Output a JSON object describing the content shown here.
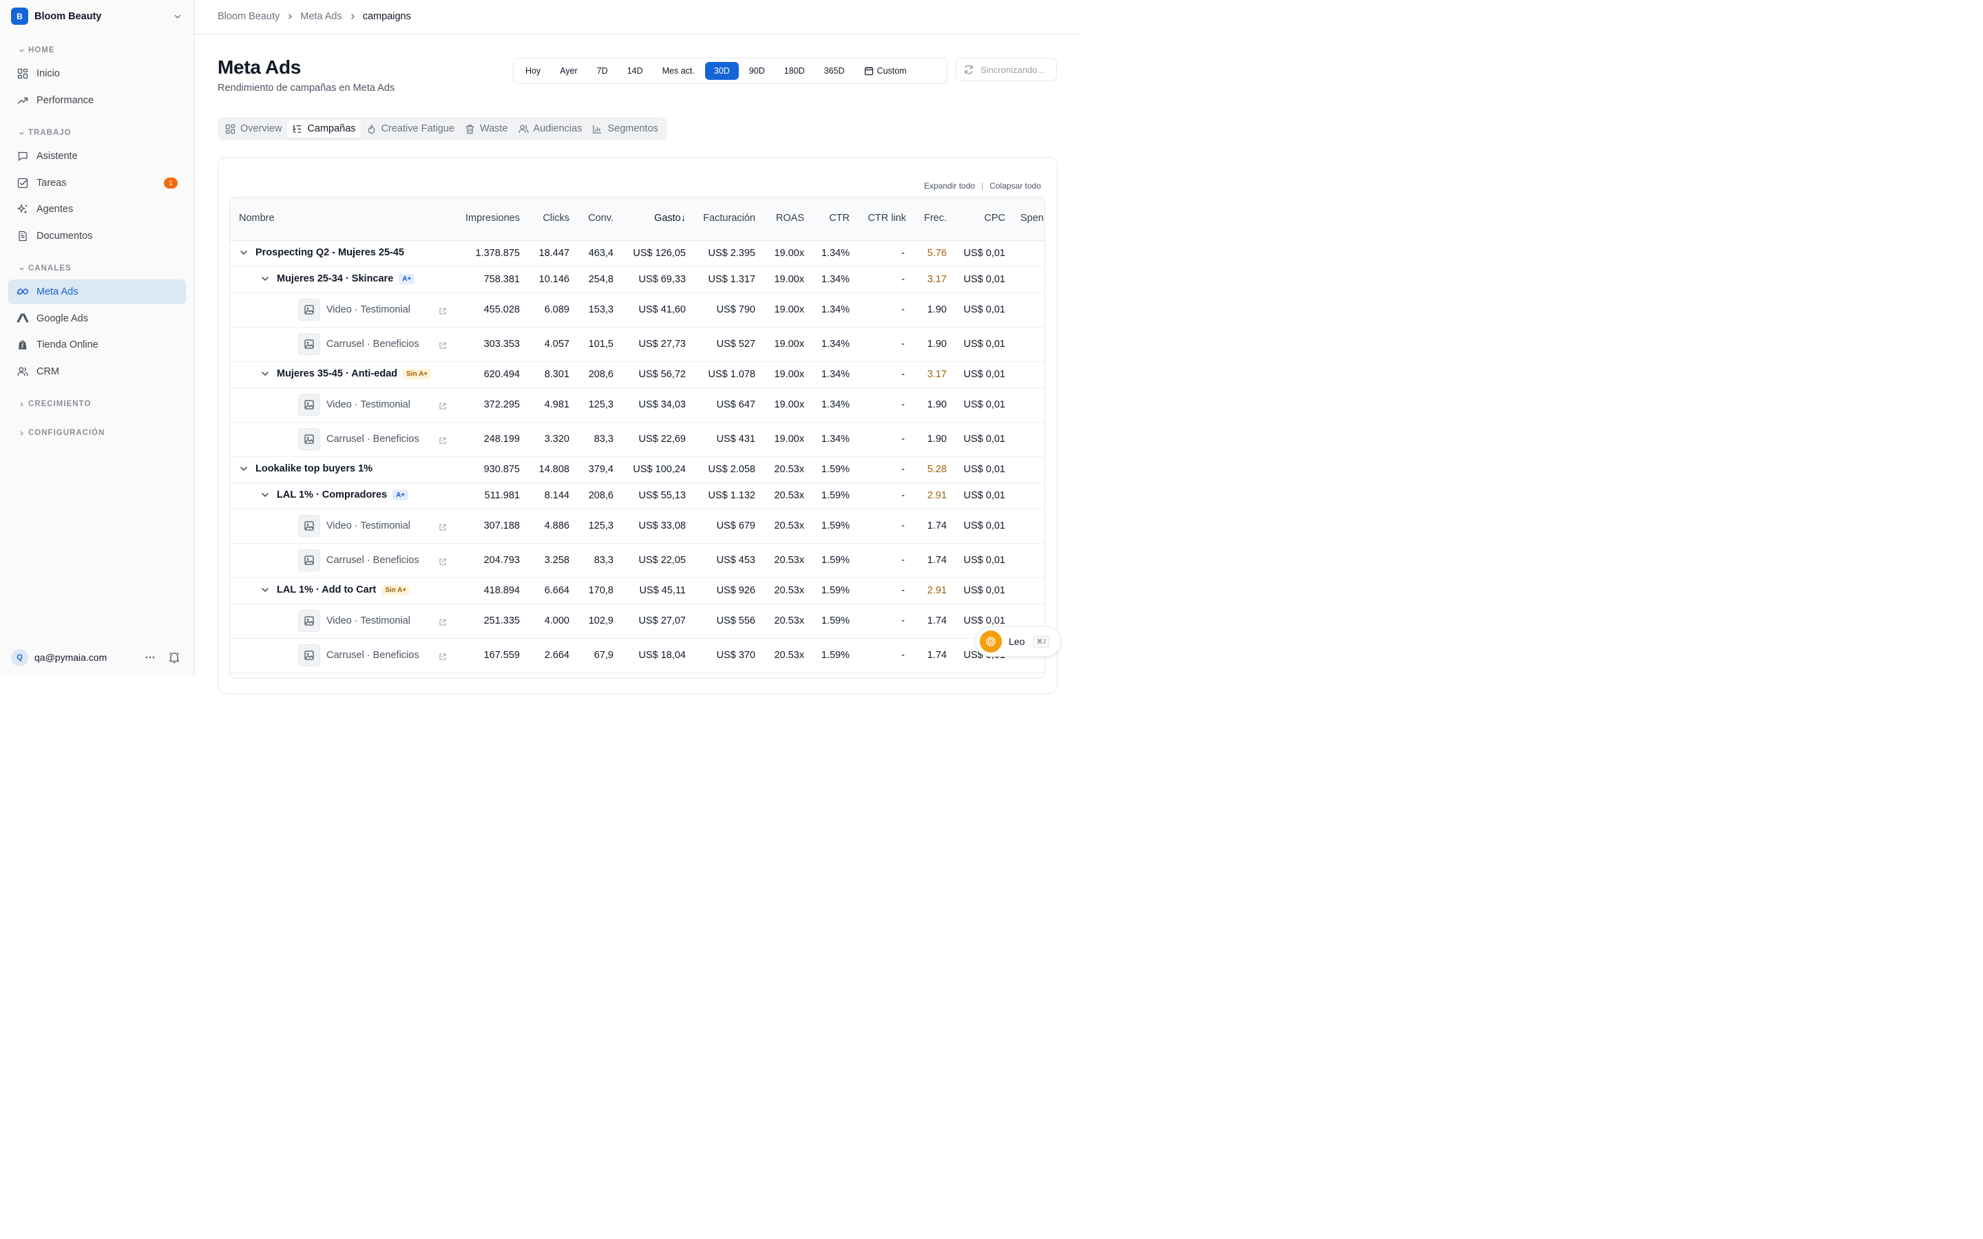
{
  "brand": {
    "initial": "B",
    "name": "Bloom Beauty"
  },
  "sidebar": {
    "sections": [
      {
        "label": "HOME",
        "items": [
          {
            "label": "Inicio",
            "icon": "grid-icon"
          },
          {
            "label": "Performance",
            "icon": "trend-icon"
          }
        ]
      },
      {
        "label": "TRABAJO",
        "items": [
          {
            "label": "Asistente",
            "icon": "chat-icon"
          },
          {
            "label": "Tareas",
            "icon": "checkbox-icon",
            "badge": "1"
          },
          {
            "label": "Agentes",
            "icon": "sparkle-icon"
          },
          {
            "label": "Documentos",
            "icon": "document-icon"
          }
        ]
      },
      {
        "label": "CANALES",
        "items": [
          {
            "label": "Meta Ads",
            "icon": "meta-icon",
            "active": true
          },
          {
            "label": "Google Ads",
            "icon": "google-ads-icon"
          },
          {
            "label": "Tienda Online",
            "icon": "shopify-icon"
          },
          {
            "label": "CRM",
            "icon": "users-icon"
          }
        ]
      },
      {
        "label": "CRECIMIENTO",
        "collapsed": true
      },
      {
        "label": "CONFIGURACIÓN",
        "collapsed": true
      }
    ],
    "user": {
      "initial": "Q",
      "email": "qa@pymaia.com"
    }
  },
  "breadcrumb": [
    "Bloom Beauty",
    "Meta Ads",
    "campaigns"
  ],
  "header": {
    "title": "Meta Ads",
    "subtitle": "Rendimiento de campañas en Meta Ads"
  },
  "date_range": {
    "options": [
      "Hoy",
      "Ayer",
      "7D",
      "14D",
      "Mes act.",
      "30D",
      "90D",
      "180D",
      "365D"
    ],
    "selected": "30D",
    "custom_label": "Custom"
  },
  "sync_label": "Sincronizando...",
  "tabs": [
    {
      "label": "Overview",
      "icon": "grid-icon"
    },
    {
      "label": "Campañas",
      "icon": "list-tree-icon",
      "active": true
    },
    {
      "label": "Creative Fatigue",
      "icon": "flame-icon"
    },
    {
      "label": "Waste",
      "icon": "trash-icon"
    },
    {
      "label": "Audiencias",
      "icon": "users-icon"
    },
    {
      "label": "Segmentos",
      "icon": "bar-chart-icon"
    }
  ],
  "table_actions": {
    "expand": "Expandir todo",
    "separator": "|",
    "collapse": "Colapsar todo"
  },
  "table": {
    "columns": [
      "Nombre",
      "Impresiones",
      "Clicks",
      "Conv.",
      "Gasto",
      "Facturación",
      "ROAS",
      "CTR",
      "CTR link",
      "Frec.",
      "CPC",
      "Spen"
    ],
    "sort_indicator": "↓",
    "rows": [
      {
        "level": 0,
        "name": "Prospecting Q2 - Mujeres 25-45",
        "values": [
          "1.378.875",
          "18.447",
          "463,4",
          "US$ 126,05",
          "US$ 2.395",
          "19.00x",
          "1.34%",
          "-",
          "5.76",
          "US$ 0,01"
        ],
        "freq_high": true
      },
      {
        "level": 1,
        "name": "Mujeres 25-34 · Skincare",
        "tag": "A+",
        "values": [
          "758.381",
          "10.146",
          "254,8",
          "US$ 69,33",
          "US$ 1.317",
          "19.00x",
          "1.34%",
          "-",
          "3.17",
          "US$ 0,01"
        ],
        "freq_high": true
      },
      {
        "level": 2,
        "name": "Video · Testimonial",
        "values": [
          "455.028",
          "6.089",
          "153,3",
          "US$ 41,60",
          "US$ 790",
          "19.00x",
          "1.34%",
          "-",
          "1.90",
          "US$ 0,01"
        ]
      },
      {
        "level": 2,
        "name": "Carrusel · Beneficios",
        "values": [
          "303.353",
          "4.057",
          "101,5",
          "US$ 27,73",
          "US$ 527",
          "19.00x",
          "1.34%",
          "-",
          "1.90",
          "US$ 0,01"
        ]
      },
      {
        "level": 1,
        "name": "Mujeres 35-45 · Anti-edad",
        "tag": "Sin A+",
        "values": [
          "620.494",
          "8.301",
          "208,6",
          "US$ 56,72",
          "US$ 1.078",
          "19.00x",
          "1.34%",
          "-",
          "3.17",
          "US$ 0,01"
        ],
        "freq_high": true
      },
      {
        "level": 2,
        "name": "Video · Testimonial",
        "values": [
          "372.295",
          "4.981",
          "125,3",
          "US$ 34,03",
          "US$ 647",
          "19.00x",
          "1.34%",
          "-",
          "1.90",
          "US$ 0,01"
        ]
      },
      {
        "level": 2,
        "name": "Carrusel · Beneficios",
        "values": [
          "248.199",
          "3.320",
          "83,3",
          "US$ 22,69",
          "US$ 431",
          "19.00x",
          "1.34%",
          "-",
          "1.90",
          "US$ 0,01"
        ]
      },
      {
        "level": 0,
        "name": "Lookalike top buyers 1%",
        "values": [
          "930.875",
          "14.808",
          "379,4",
          "US$ 100,24",
          "US$ 2.058",
          "20.53x",
          "1.59%",
          "-",
          "5.28",
          "US$ 0,01"
        ],
        "freq_high": true
      },
      {
        "level": 1,
        "name": "LAL 1% · Compradores",
        "tag": "A+",
        "values": [
          "511.981",
          "8.144",
          "208,6",
          "US$ 55,13",
          "US$ 1.132",
          "20.53x",
          "1.59%",
          "-",
          "2.91",
          "US$ 0,01"
        ],
        "freq_high": true
      },
      {
        "level": 2,
        "name": "Video · Testimonial",
        "values": [
          "307.188",
          "4.886",
          "125,3",
          "US$ 33,08",
          "US$ 679",
          "20.53x",
          "1.59%",
          "-",
          "1.74",
          "US$ 0,01"
        ]
      },
      {
        "level": 2,
        "name": "Carrusel · Beneficios",
        "values": [
          "204.793",
          "3.258",
          "83,3",
          "US$ 22,05",
          "US$ 453",
          "20.53x",
          "1.59%",
          "-",
          "1.74",
          "US$ 0,01"
        ]
      },
      {
        "level": 1,
        "name": "LAL 1% · Add to Cart",
        "tag": "Sin A+",
        "values": [
          "418.894",
          "6.664",
          "170,8",
          "US$ 45,11",
          "US$ 926",
          "20.53x",
          "1.59%",
          "-",
          "2.91",
          "US$ 0,01"
        ],
        "freq_high": true
      },
      {
        "level": 2,
        "name": "Video · Testimonial",
        "values": [
          "251.335",
          "4.000",
          "102,9",
          "US$ 27,07",
          "US$ 556",
          "20.53x",
          "1.59%",
          "-",
          "1.74",
          "US$ 0,01"
        ]
      },
      {
        "level": 2,
        "name": "Carrusel · Beneficios",
        "values": [
          "167.559",
          "2.664",
          "67,9",
          "US$ 18,04",
          "US$ 370",
          "20.53x",
          "1.59%",
          "-",
          "1.74",
          "US$ 0,01"
        ]
      }
    ]
  },
  "assistant": {
    "name": "Leo",
    "shortcut": "⌘J"
  },
  "colors": {
    "accent": "#1565d8",
    "badge": "#f26b10",
    "freq_high": "#a16207"
  }
}
